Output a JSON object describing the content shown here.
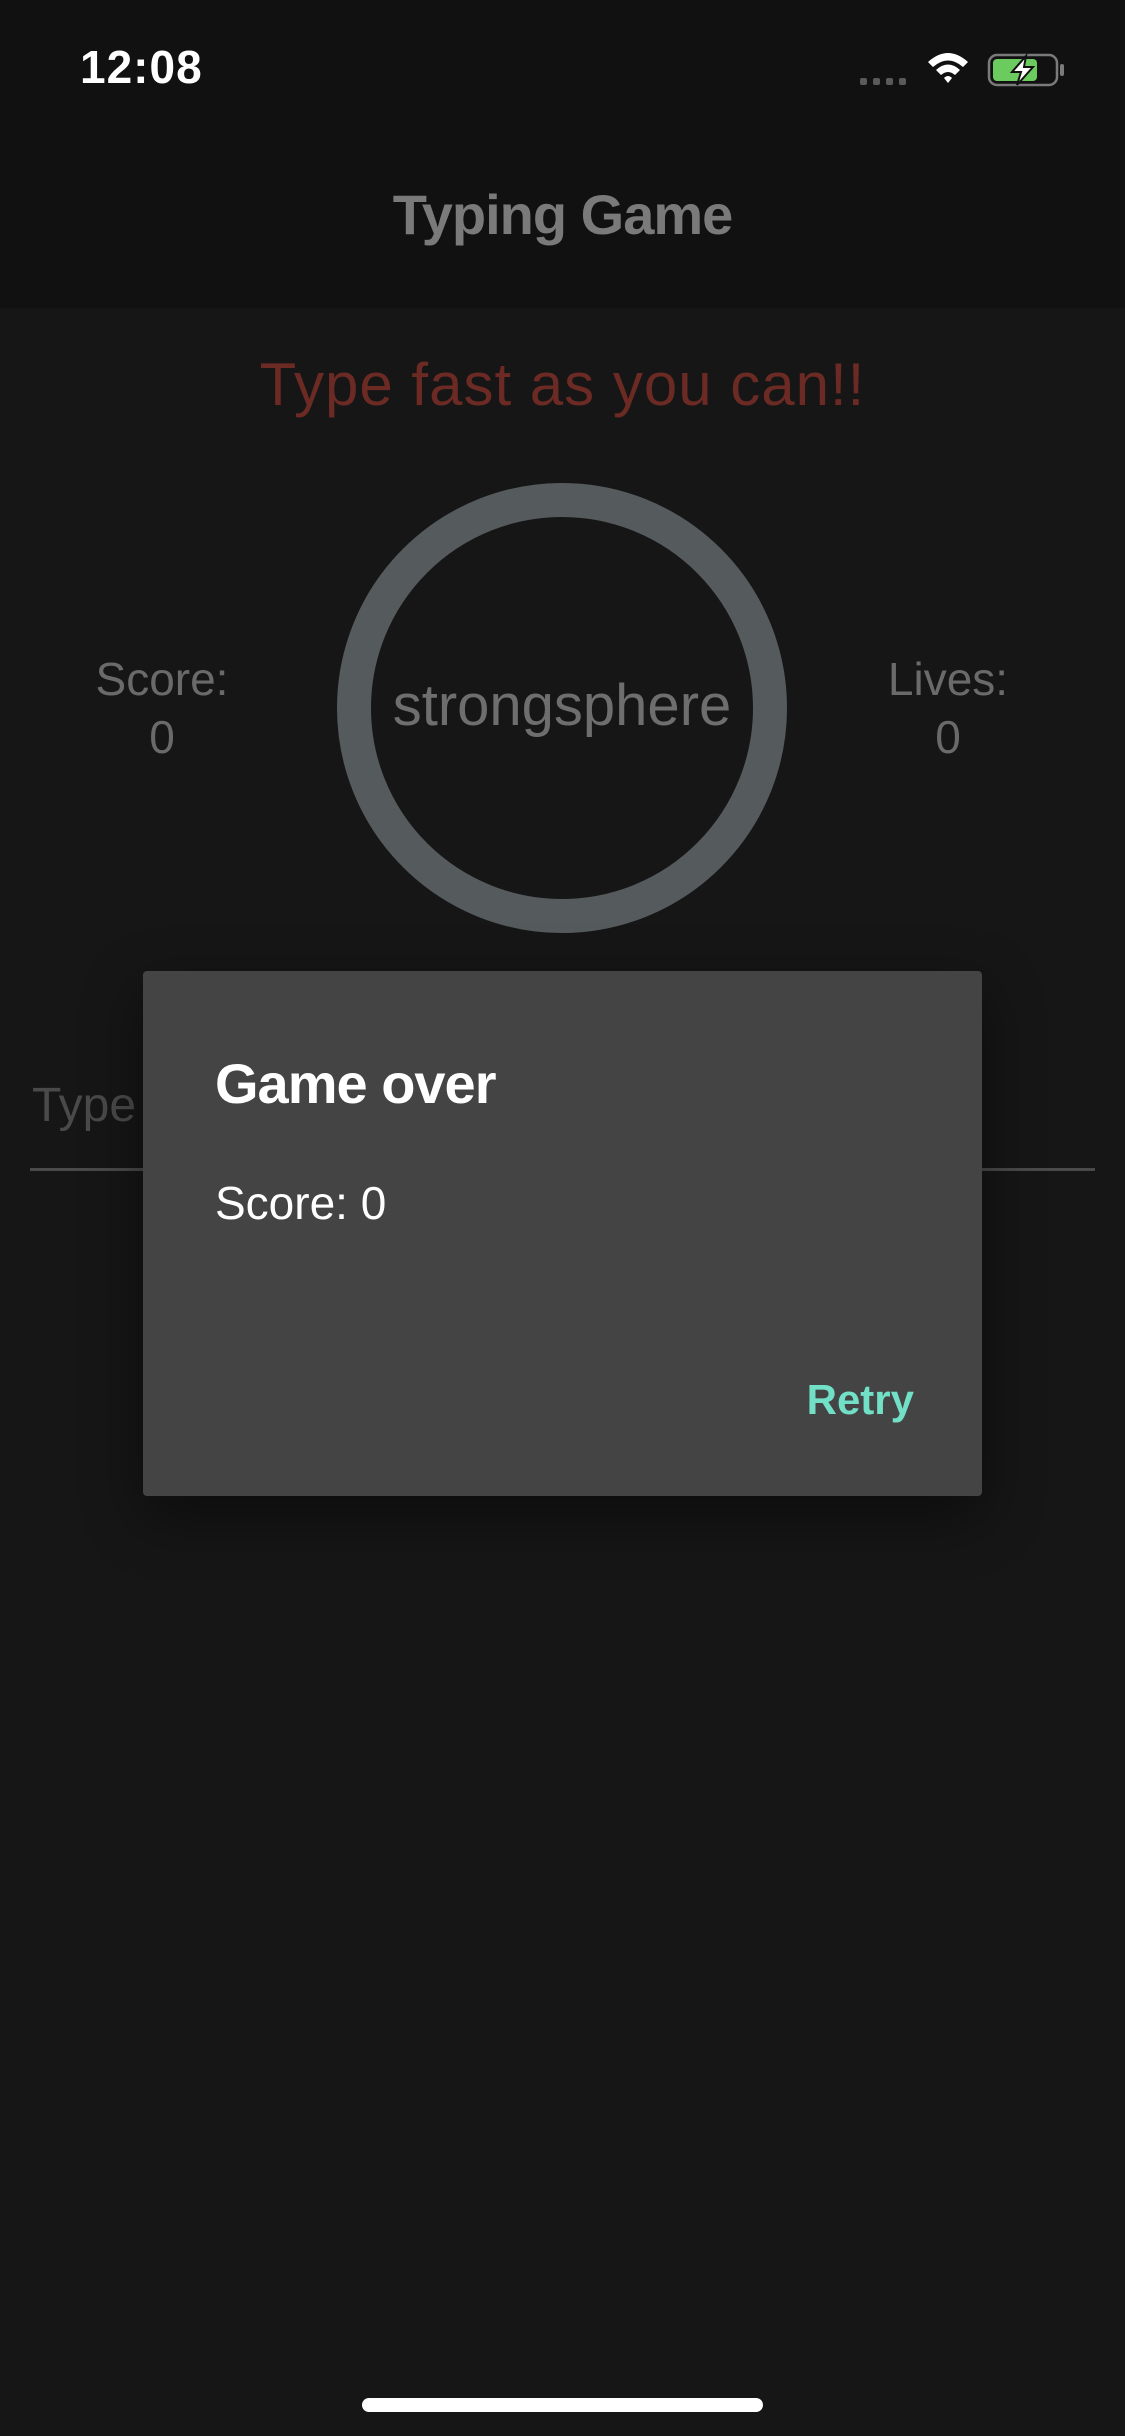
{
  "status_bar": {
    "time": "12:08",
    "icons": [
      "signal-dots-icon",
      "wifi-icon",
      "battery-charging-icon"
    ],
    "battery_color": "#6ccb5f"
  },
  "app_bar": {
    "title": "Typing Game"
  },
  "game": {
    "headline": "Type fast as you can!!",
    "score_label": "Score:",
    "score_value": "0",
    "lives_label": "Lives:",
    "lives_value": "0",
    "current_word": "strongsphere",
    "input_placeholder": "Type"
  },
  "dialog": {
    "title": "Game over",
    "body": "Score: 0",
    "retry_label": "Retry",
    "accent_color": "#71e0c7"
  }
}
